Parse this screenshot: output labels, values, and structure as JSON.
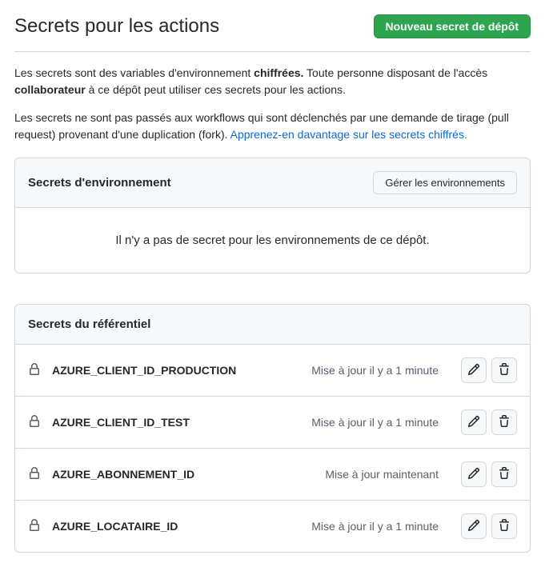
{
  "header": {
    "title": "Secrets pour les actions",
    "new_secret_btn": "Nouveau secret de dépôt"
  },
  "intro": {
    "p1_a": "Les secrets sont des variables d'environnement ",
    "p1_b": "chiffrées.",
    "p1_c": " Toute personne disposant de l'accès ",
    "p1_d": "collaborateur",
    "p1_e": " à ce dépôt peut utiliser ces secrets pour les actions.",
    "p2_a": "Les secrets ne sont pas passés aux workflows qui sont déclenchés par une demande de tirage (pull request) provenant d'une duplication (fork). ",
    "p2_link": "Apprenez-en davantage sur les secrets chiffrés."
  },
  "env_panel": {
    "title": "Secrets d'environnement",
    "manage_btn": "Gérer les environnements",
    "empty_msg": "Il n'y a pas de secret pour les environnements de ce dépôt."
  },
  "repo_panel": {
    "title": "Secrets du référentiel",
    "secrets": [
      {
        "name": "AZURE_CLIENT_ID_PRODUCTION",
        "updated": "Mise à jour il y a 1 minute"
      },
      {
        "name": "AZURE_CLIENT_ID_TEST",
        "updated": "Mise à jour il y a 1 minute"
      },
      {
        "name": "AZURE_ABONNEMENT_ID",
        "updated": "Mise à jour maintenant"
      },
      {
        "name": "AZURE_LOCATAIRE_ID",
        "updated": "Mise à jour il y a 1 minute"
      }
    ]
  }
}
